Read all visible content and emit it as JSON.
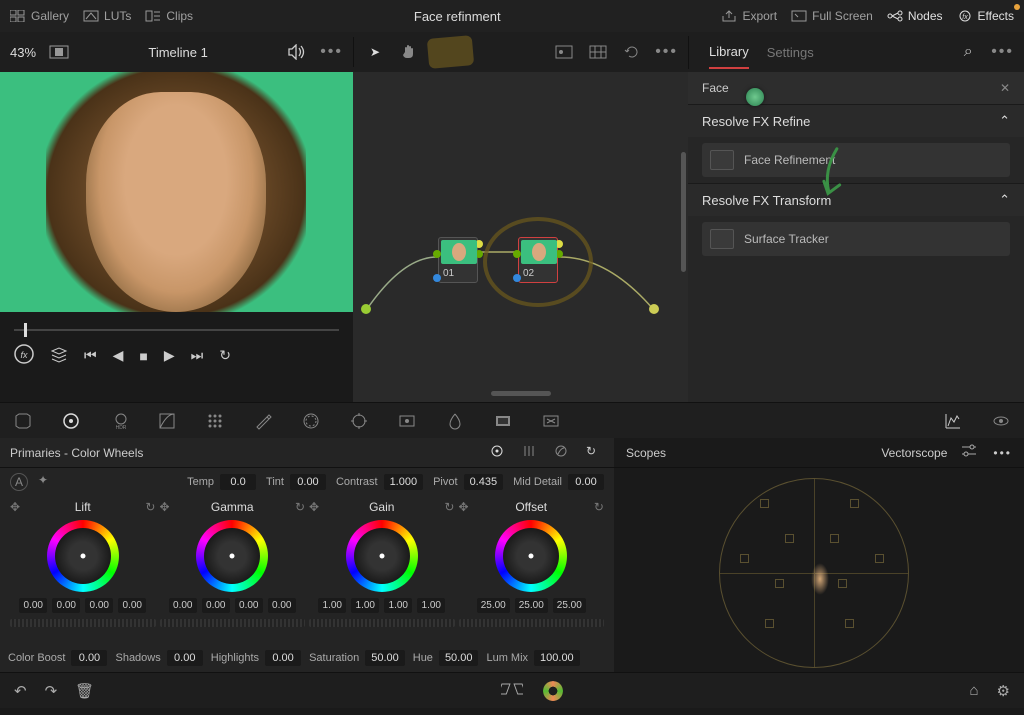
{
  "topbar": {
    "gallery": "Gallery",
    "luts": "LUTs",
    "clips": "Clips",
    "title": "Face refinment",
    "export": "Export",
    "fullscreen": "Full Screen",
    "nodes": "Nodes",
    "effects": "Effects"
  },
  "toolbar": {
    "zoom": "43%",
    "timeline": "Timeline 1"
  },
  "nodes": {
    "n1": "01",
    "n2": "02"
  },
  "fx": {
    "tab_library": "Library",
    "tab_settings": "Settings",
    "search": "Face",
    "section_refine": "Resolve FX Refine",
    "entry_face": "Face Refinement",
    "section_transform": "Resolve FX Transform",
    "entry_surface": "Surface Tracker"
  },
  "primaries": {
    "title": "Primaries - Color Wheels",
    "temp_l": "Temp",
    "temp_v": "0.0",
    "tint_l": "Tint",
    "tint_v": "0.00",
    "contrast_l": "Contrast",
    "contrast_v": "1.000",
    "pivot_l": "Pivot",
    "pivot_v": "0.435",
    "middetail_l": "Mid Detail",
    "middetail_v": "0.00",
    "wheels": [
      {
        "name": "Lift",
        "vals": [
          "0.00",
          "0.00",
          "0.00",
          "0.00"
        ]
      },
      {
        "name": "Gamma",
        "vals": [
          "0.00",
          "0.00",
          "0.00",
          "0.00"
        ]
      },
      {
        "name": "Gain",
        "vals": [
          "1.00",
          "1.00",
          "1.00",
          "1.00"
        ]
      },
      {
        "name": "Offset",
        "vals": [
          "25.00",
          "25.00",
          "25.00"
        ]
      }
    ],
    "colorboost_l": "Color Boost",
    "colorboost_v": "0.00",
    "shadows_l": "Shadows",
    "shadows_v": "0.00",
    "highlights_l": "Highlights",
    "highlights_v": "0.00",
    "saturation_l": "Saturation",
    "saturation_v": "50.00",
    "hue_l": "Hue",
    "hue_v": "50.00",
    "lummix_l": "Lum Mix",
    "lummix_v": "100.00"
  },
  "scopes": {
    "title": "Scopes",
    "type": "Vectorscope"
  }
}
